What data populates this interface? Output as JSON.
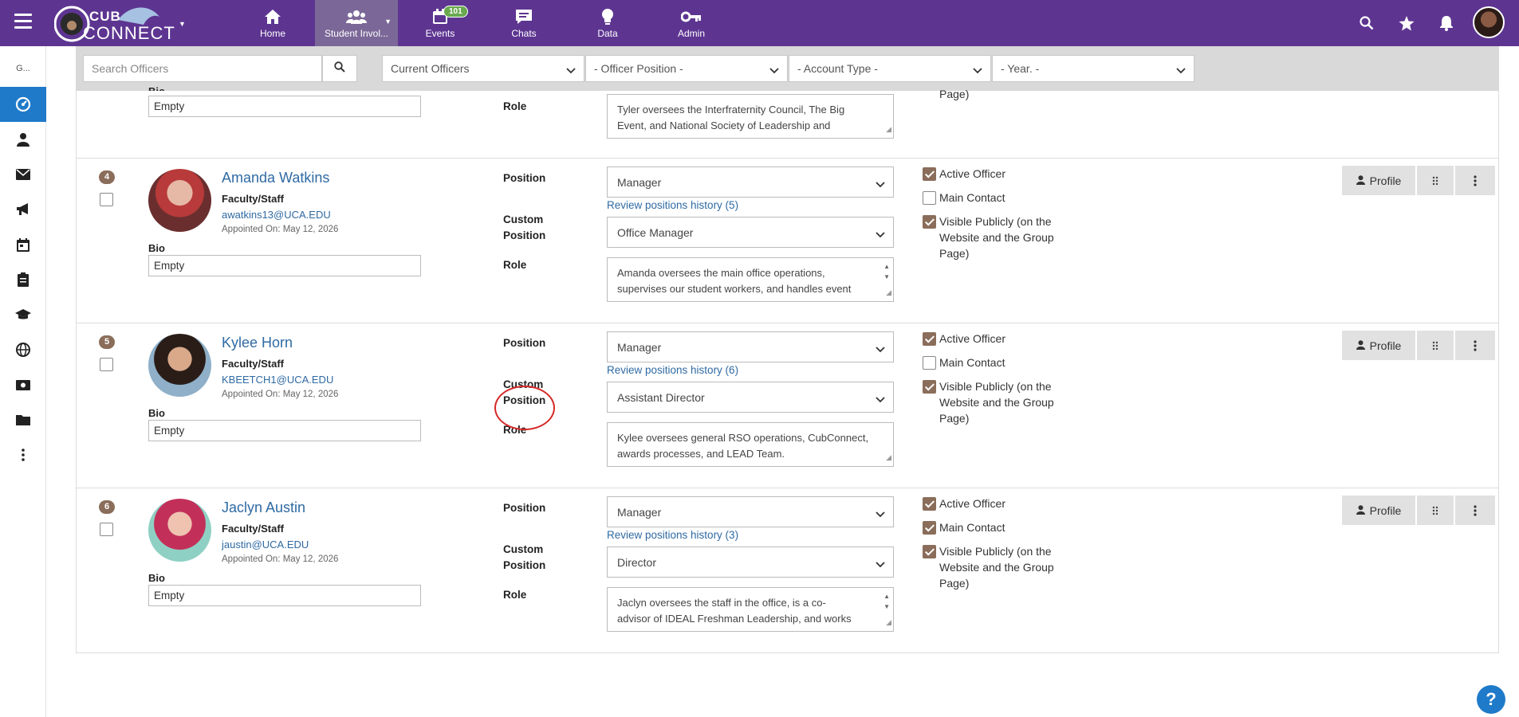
{
  "nav": {
    "logo_text": "CUB CONNECT",
    "items": [
      {
        "label": "Home",
        "icon": "home-icon"
      },
      {
        "label": "Student Invol...",
        "icon": "group-icon"
      },
      {
        "label": "Events",
        "icon": "calendar-icon",
        "badge": "101"
      },
      {
        "label": "Chats",
        "icon": "chat-icon"
      },
      {
        "label": "Data",
        "icon": "lightbulb-icon"
      },
      {
        "label": "Admin",
        "icon": "key-icon"
      }
    ]
  },
  "sidebar": {
    "top_label": "G...",
    "icons": [
      "dashboard-icon",
      "person-icon",
      "mail-icon",
      "megaphone-icon",
      "calendar-icon",
      "clipboard-icon",
      "graduation-cap-icon",
      "globe-icon",
      "money-icon",
      "folder-icon",
      "more-icon"
    ]
  },
  "filters": {
    "search_placeholder": "Search Officers",
    "status": "Current Officers",
    "position": "- Officer Position -",
    "account_type": "- Account Type -",
    "year": "- Year. -"
  },
  "labels": {
    "bio": "Bio",
    "position": "Position",
    "custom_position_1": "Custom",
    "custom_position_2": "Position",
    "role": "Role",
    "active_officer": "Active Officer",
    "main_contact": "Main Contact",
    "visible_1": "Visible Publicly (on the",
    "visible_2": "Website and the Group",
    "visible_3": "Page)",
    "profile": "Profile"
  },
  "partial_row": {
    "bio_label_cut": "Bio",
    "bio": "Empty",
    "role_line1": "Tyler oversees the Interfraternity Council, The Big",
    "role_line2": "Event, and National Society of Leadership and",
    "visible_cut": "Page)"
  },
  "officers": [
    {
      "num": "4",
      "name": "Amanda Watkins",
      "type": "Faculty/Staff",
      "email": "awatkins13@UCA.EDU",
      "appointed": "Appointed On: May 12, 2026",
      "bio": "Empty",
      "position": "Manager",
      "history": "Review positions history (5)",
      "custom_position": "Office Manager",
      "role_line1": "Amanda oversees the main office operations,",
      "role_line2": "supervises our student workers, and handles event",
      "active": true,
      "main_contact": false,
      "visible": true
    },
    {
      "num": "5",
      "name": "Kylee Horn",
      "type": "Faculty/Staff",
      "email": "KBEETCH1@UCA.EDU",
      "appointed": "Appointed On: May 12, 2026",
      "bio": "Empty",
      "position": "Manager",
      "history": "Review positions history (6)",
      "custom_position": "Assistant Director",
      "role_line1": "Kylee oversees general RSO operations, CubConnect,",
      "role_line2": "awards processes, and LEAD Team.",
      "active": true,
      "main_contact": false,
      "visible": true
    },
    {
      "num": "6",
      "name": "Jaclyn Austin",
      "type": "Faculty/Staff",
      "email": "jaustin@UCA.EDU",
      "appointed": "Appointed On: May 12, 2026",
      "bio": "Empty",
      "position": "Manager",
      "history": "Review positions history (3)",
      "custom_position": "Director",
      "role_line1": "Jaclyn oversees the staff in the office, is a co-",
      "role_line2": "advisor of IDEAL Freshman Leadership, and works",
      "active": true,
      "main_contact": true,
      "visible": true
    }
  ],
  "colors": {
    "nav_bg": "#5d3591",
    "link": "#2f6aa3",
    "checkbox": "#8a6d5a",
    "sidebar_active": "#1f7ac9",
    "annotation": "#d62828"
  },
  "help_label": "?"
}
